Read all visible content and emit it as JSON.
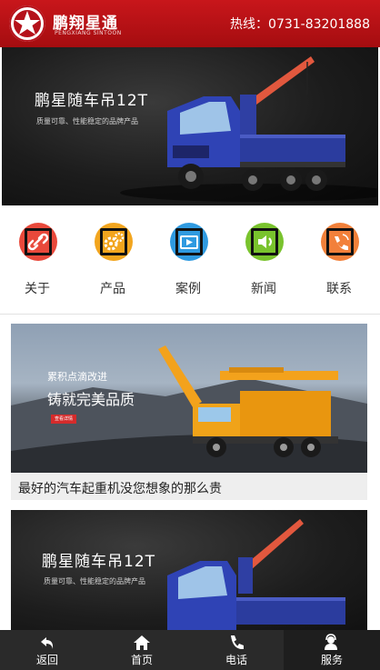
{
  "header": {
    "brand_name": "鹏翔星通",
    "brand_sub": "PENGXIANG SINTOON",
    "hotline": "热线：0731-83201888"
  },
  "hero": {
    "title": "鹏星随车吊12T",
    "subtitle": "质量可靠、性能稳定的品牌产品"
  },
  "nav": [
    {
      "label": "关于",
      "icon": "link-icon",
      "color": "#e8493b"
    },
    {
      "label": "产品",
      "icon": "gears-icon",
      "color": "#f2a51e"
    },
    {
      "label": "案例",
      "icon": "video-icon",
      "color": "#2f9ae0"
    },
    {
      "label": "新闻",
      "icon": "speaker-icon",
      "color": "#79c32d"
    },
    {
      "label": "联系",
      "icon": "phone-icon",
      "color": "#f2803a"
    }
  ],
  "news": [
    {
      "slogan_line1": "累积点滴改进",
      "slogan_line2": "铸就完美品质",
      "button": "查看详情",
      "caption": "最好的汽车起重机没您想象的那么贵"
    },
    {
      "title": "鹏星随车吊12T",
      "subtitle": "质量可靠、性能稳定的品牌产品"
    }
  ],
  "bottom_nav": [
    {
      "label": "返回",
      "icon": "back-arrow-icon"
    },
    {
      "label": "首页",
      "icon": "home-icon"
    },
    {
      "label": "电话",
      "icon": "phone-icon"
    },
    {
      "label": "服务",
      "icon": "service-icon"
    }
  ],
  "colors": {
    "header": "#b5121b",
    "bottom_bar": "#2a2a2a"
  }
}
